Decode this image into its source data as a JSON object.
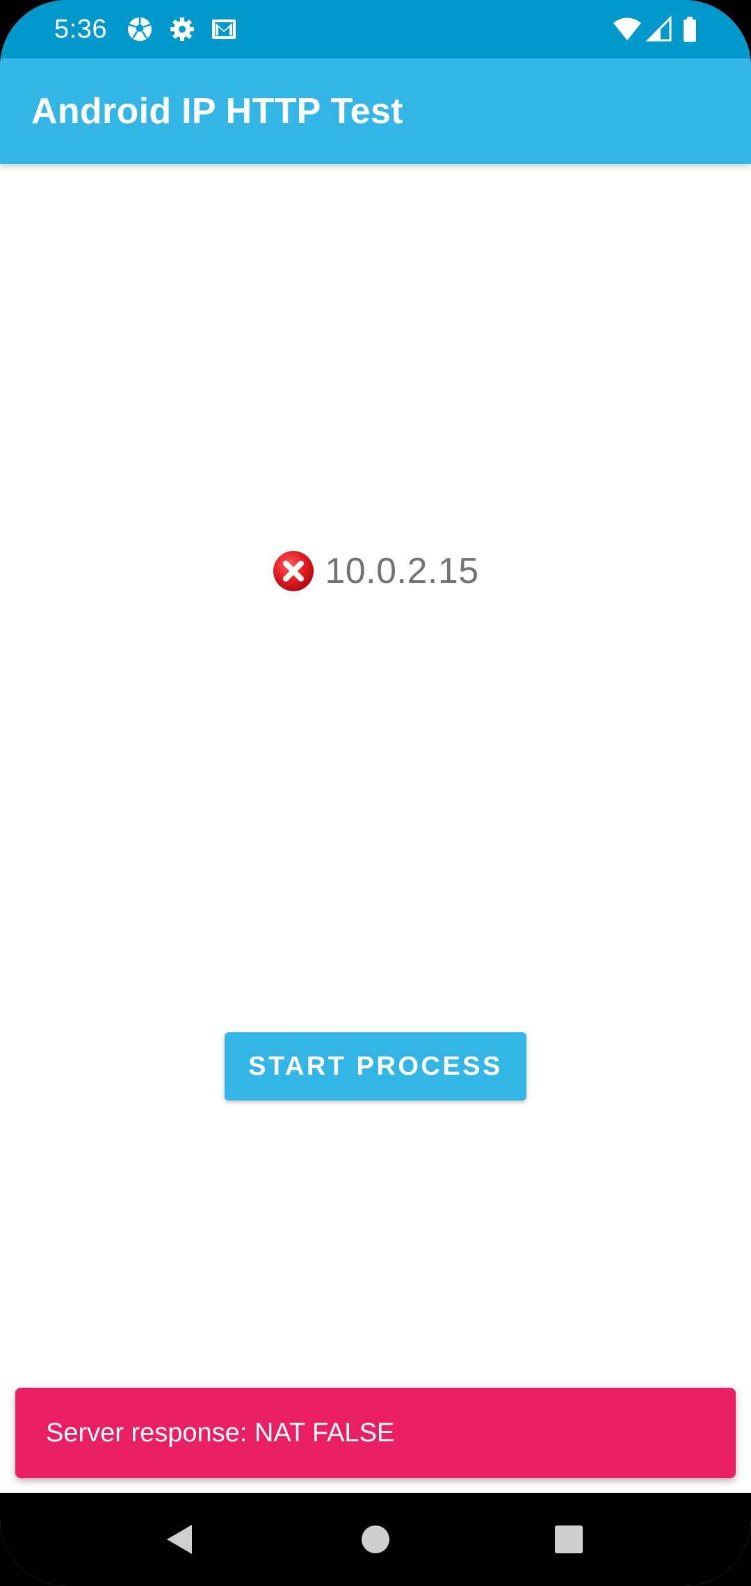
{
  "status_bar": {
    "time": "5:36",
    "left_icons": [
      "soccer-ball-icon",
      "gear-icon",
      "mail-icon"
    ],
    "right_icons": [
      "wifi-icon",
      "cell-signal-icon",
      "battery-icon"
    ],
    "background": "#0199cc"
  },
  "app_bar": {
    "title": "Android IP HTTP Test",
    "background": "#33b5e5"
  },
  "main": {
    "status_icon": "error-x-icon",
    "status_icon_color": "#e31b23",
    "ip_address": "10.0.2.15",
    "start_button_label": "START PROCESS",
    "button_color": "#33b5e5"
  },
  "snackbar": {
    "message": "Server response: NAT FALSE",
    "background": "#e91e63"
  },
  "nav_bar": {
    "buttons": [
      "back-icon",
      "home-icon",
      "recents-icon"
    ]
  }
}
